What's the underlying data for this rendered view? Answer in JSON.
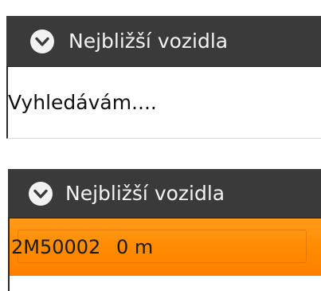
{
  "panels": [
    {
      "header": {
        "title": "Nejbližší vozidla",
        "icon": "chevron-down-circle-icon"
      },
      "status_text": "Vyhledávám...."
    },
    {
      "header": {
        "title": "Nejbližší vozidla",
        "icon": "chevron-down-circle-icon"
      },
      "vehicle": {
        "id": "2M50002",
        "distance": "0 m"
      },
      "colors": {
        "highlight": "#ff8a00"
      }
    }
  ],
  "colors": {
    "header_bg": "#3a3a3a",
    "header_text": "#f2f2f2"
  }
}
